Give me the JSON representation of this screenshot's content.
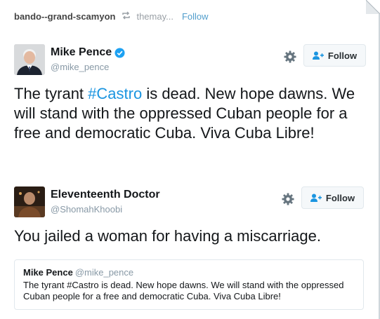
{
  "post_header": {
    "username": "bando--grand-scamyon",
    "reblog_icon": "reblog-icon",
    "source": "themay...",
    "follow_label": "Follow"
  },
  "tweet1": {
    "display_name": "Mike Pence",
    "handle": "@mike_pence",
    "verified_icon": "verified-badge-icon",
    "follow_label": "Follow",
    "text_before": "The tyrant ",
    "hashtag": "#Castro",
    "text_after": " is dead. New hope dawns. We will stand with the oppressed Cuban people for a free and democratic Cuba. Viva Cuba Libre!"
  },
  "tweet2": {
    "display_name": "Eleventeenth Doctor",
    "handle": "@ShomahKhoobi",
    "follow_label": "Follow",
    "text": "You jailed a woman for having a miscarriage."
  },
  "quote": {
    "name": "Mike Pence",
    "handle": "@mike_pence",
    "text": "The tyrant #Castro is dead. New hope dawns. We will stand with the oppressed Cuban people for a free and democratic Cuba. Viva Cuba Libre!"
  },
  "colors": {
    "link_blue": "#1b95e0",
    "tumblr_blue": "#529ecc",
    "muted_gray": "#8899a6"
  }
}
